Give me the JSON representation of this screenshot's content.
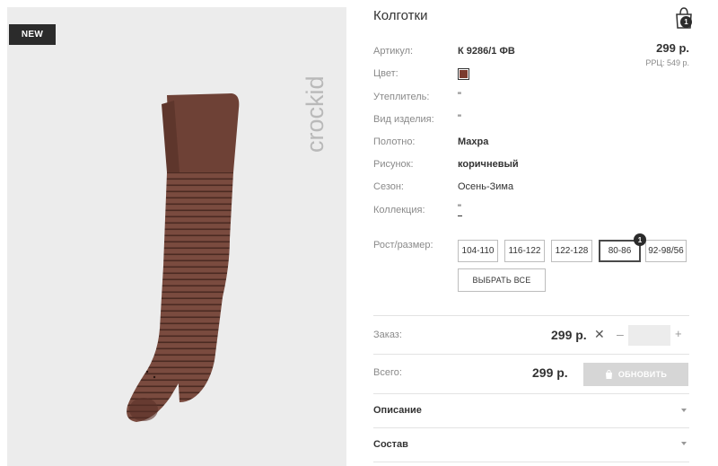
{
  "badge": "NEW",
  "brand": "crockid",
  "product": {
    "title": "Колготки",
    "cart_count": "1",
    "price": "299 р.",
    "rrp": "РРЦ: 549 р."
  },
  "attributes": [
    {
      "label": "Артикул:",
      "value": "К 9286/1 ФВ"
    },
    {
      "label": "Цвет:",
      "value": ""
    },
    {
      "label": "Утеплитель:",
      "value": "\""
    },
    {
      "label": "Вид изделия:",
      "value": "\""
    },
    {
      "label": "Полотно:",
      "value": "Махра"
    },
    {
      "label": "Рисунок:",
      "value": "коричневый"
    },
    {
      "label": "Сезон:",
      "value": "Осень-Зима"
    },
    {
      "label": "Коллекция:",
      "value": "\""
    }
  ],
  "color_swatch": "#7b3b2e",
  "sizes": {
    "label": "Рост/размер:",
    "options": [
      "104-110",
      "116-122",
      "122-128",
      "80-86",
      "92-98/56"
    ],
    "selected": "80-86",
    "selected_count": "1",
    "select_all": "ВЫБРАТЬ ВСЕ"
  },
  "order": {
    "label": "Заказ:",
    "price": "299 р.",
    "quantity": ""
  },
  "total": {
    "label": "Всего:",
    "price": "299 р.",
    "update_label": "ОБНОВИТЬ"
  },
  "accordion": [
    {
      "title": "Описание"
    },
    {
      "title": "Состав"
    }
  ]
}
